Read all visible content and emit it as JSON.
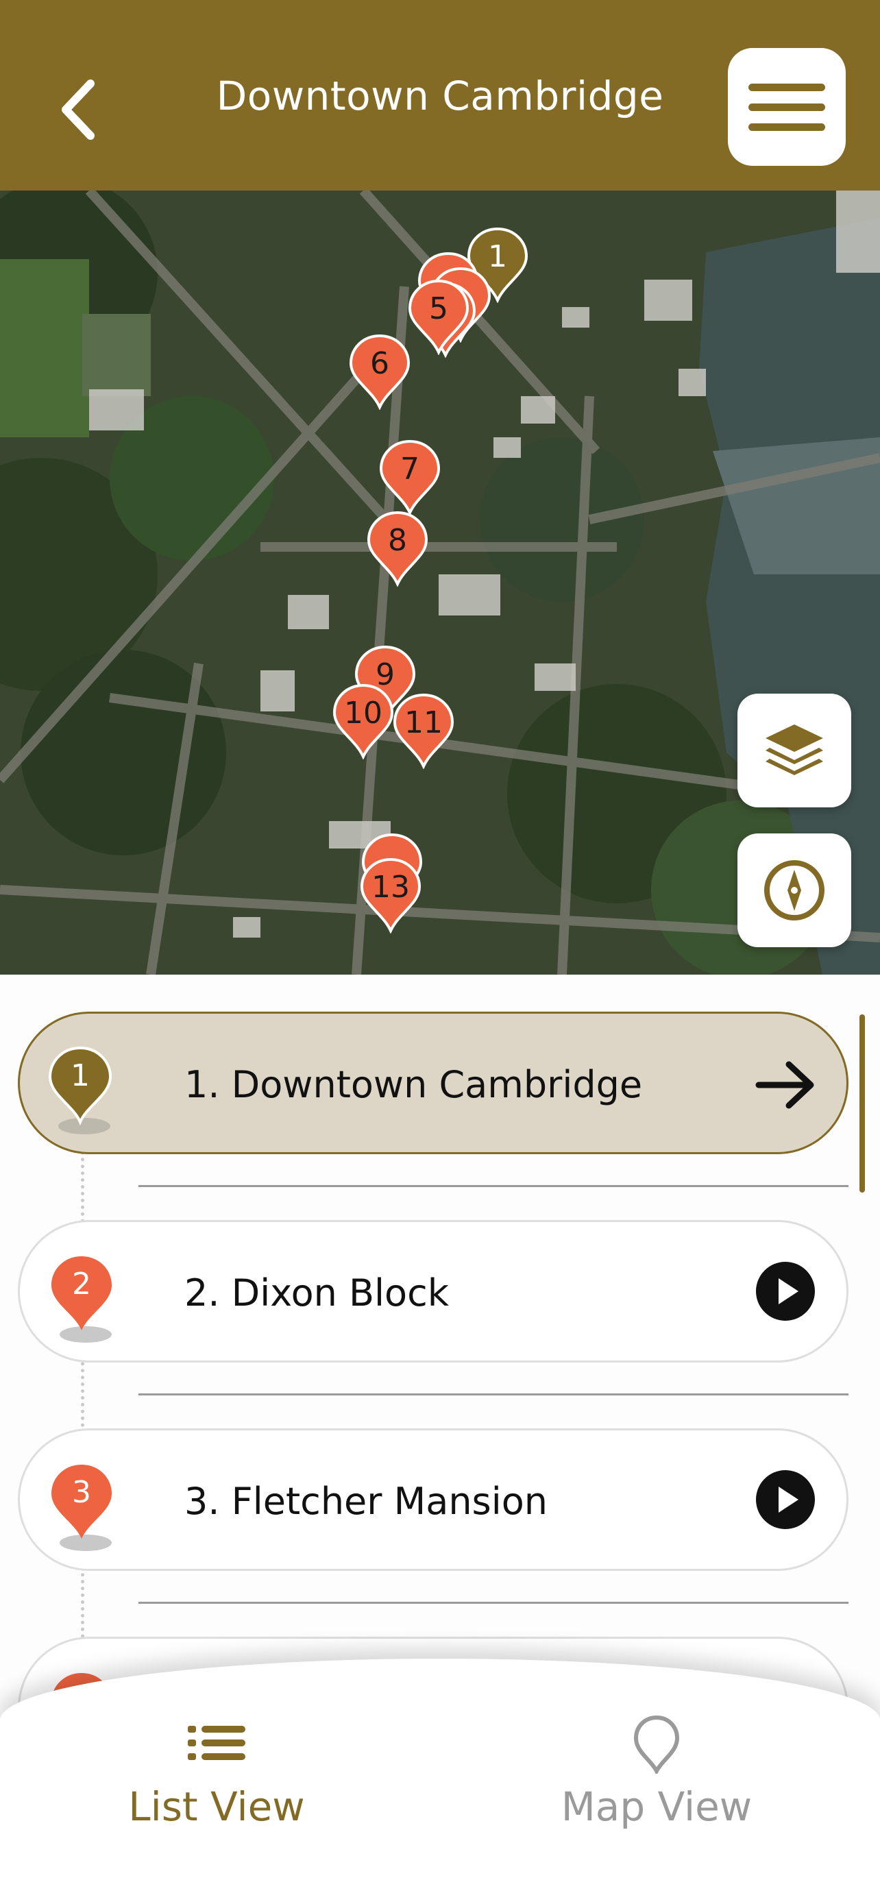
{
  "header": {
    "title": "Downtown Cambridge"
  },
  "map": {
    "markers": [
      {
        "label": "1",
        "color": "#836b25"
      },
      {
        "label": "",
        "color": "#ee6340"
      },
      {
        "label": "",
        "color": "#ee6340"
      },
      {
        "label": "",
        "color": "#ee6340"
      },
      {
        "label": "5",
        "color": "#ee6340"
      },
      {
        "label": "6",
        "color": "#ee6340"
      },
      {
        "label": "7",
        "color": "#ee6340"
      },
      {
        "label": "8",
        "color": "#ee6340"
      },
      {
        "label": "9",
        "color": "#ee6340"
      },
      {
        "label": "10",
        "color": "#ee6340"
      },
      {
        "label": "11",
        "color": "#ee6340"
      },
      {
        "label": "",
        "color": "#ee6340"
      },
      {
        "label": "13",
        "color": "#ee6340"
      }
    ],
    "buttons": [
      "layers-icon",
      "compass-icon"
    ]
  },
  "stops": [
    {
      "label": "1. Downtown Cambridge",
      "pin_number": "1",
      "pin_color": "#836b25",
      "action_icon": "arrow-right-icon",
      "active": true
    },
    {
      "label": "2. Dixon Block",
      "pin_number": "2",
      "pin_color": "#ee6340",
      "action_icon": "play-icon",
      "active": false
    },
    {
      "label": "3. Fletcher Mansion",
      "pin_number": "3",
      "pin_color": "#ee6340",
      "action_icon": "play-icon",
      "active": false
    }
  ],
  "nav": {
    "list_view": "List View",
    "map_view": "Map View",
    "active": "list_view",
    "active_color": "#836b25",
    "inactive_color": "#9a9a9a"
  }
}
